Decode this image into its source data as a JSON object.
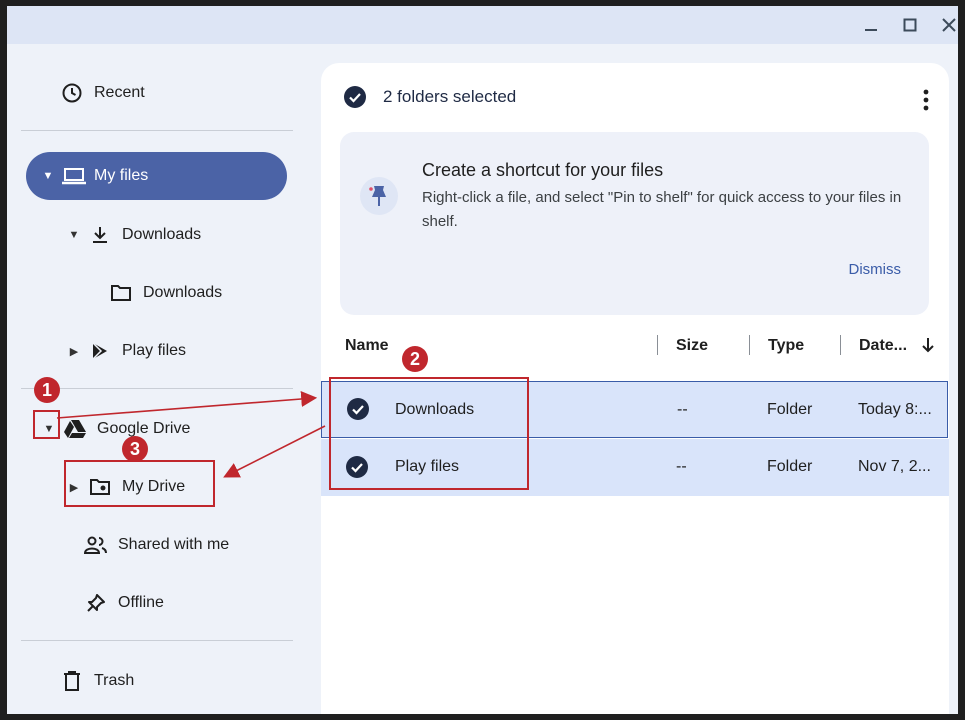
{
  "window": {
    "controls": [
      "minimize-icon",
      "maximize-icon",
      "close-icon"
    ]
  },
  "sidebar": {
    "recent": "Recent",
    "my_files": "My files",
    "downloads_group": "Downloads",
    "downloads_folder": "Downloads",
    "play_files": "Play files",
    "google_drive": "Google Drive",
    "my_drive": "My Drive",
    "shared_with_me": "Shared with me",
    "offline": "Offline",
    "trash": "Trash"
  },
  "main": {
    "selection_text": "2 folders selected",
    "banner": {
      "title": "Create a shortcut for your files",
      "text": "Right-click a file, and select \"Pin to shelf\" for quick access to your files in shelf.",
      "dismiss": "Dismiss"
    },
    "columns": {
      "name": "Name",
      "size": "Size",
      "type": "Type",
      "date": "Date..."
    },
    "rows": [
      {
        "name": "Downloads",
        "size": "--",
        "type": "Folder",
        "date": "Today 8:..."
      },
      {
        "name": "Play files",
        "size": "--",
        "type": "Folder",
        "date": "Nov 7, 2..."
      }
    ]
  },
  "annotations": {
    "badge1": "1",
    "badge2": "2",
    "badge3": "3"
  },
  "colors": {
    "accent": "#4b63a6",
    "selected_row": "#d9e4fa",
    "annotation": "#c0272d"
  }
}
